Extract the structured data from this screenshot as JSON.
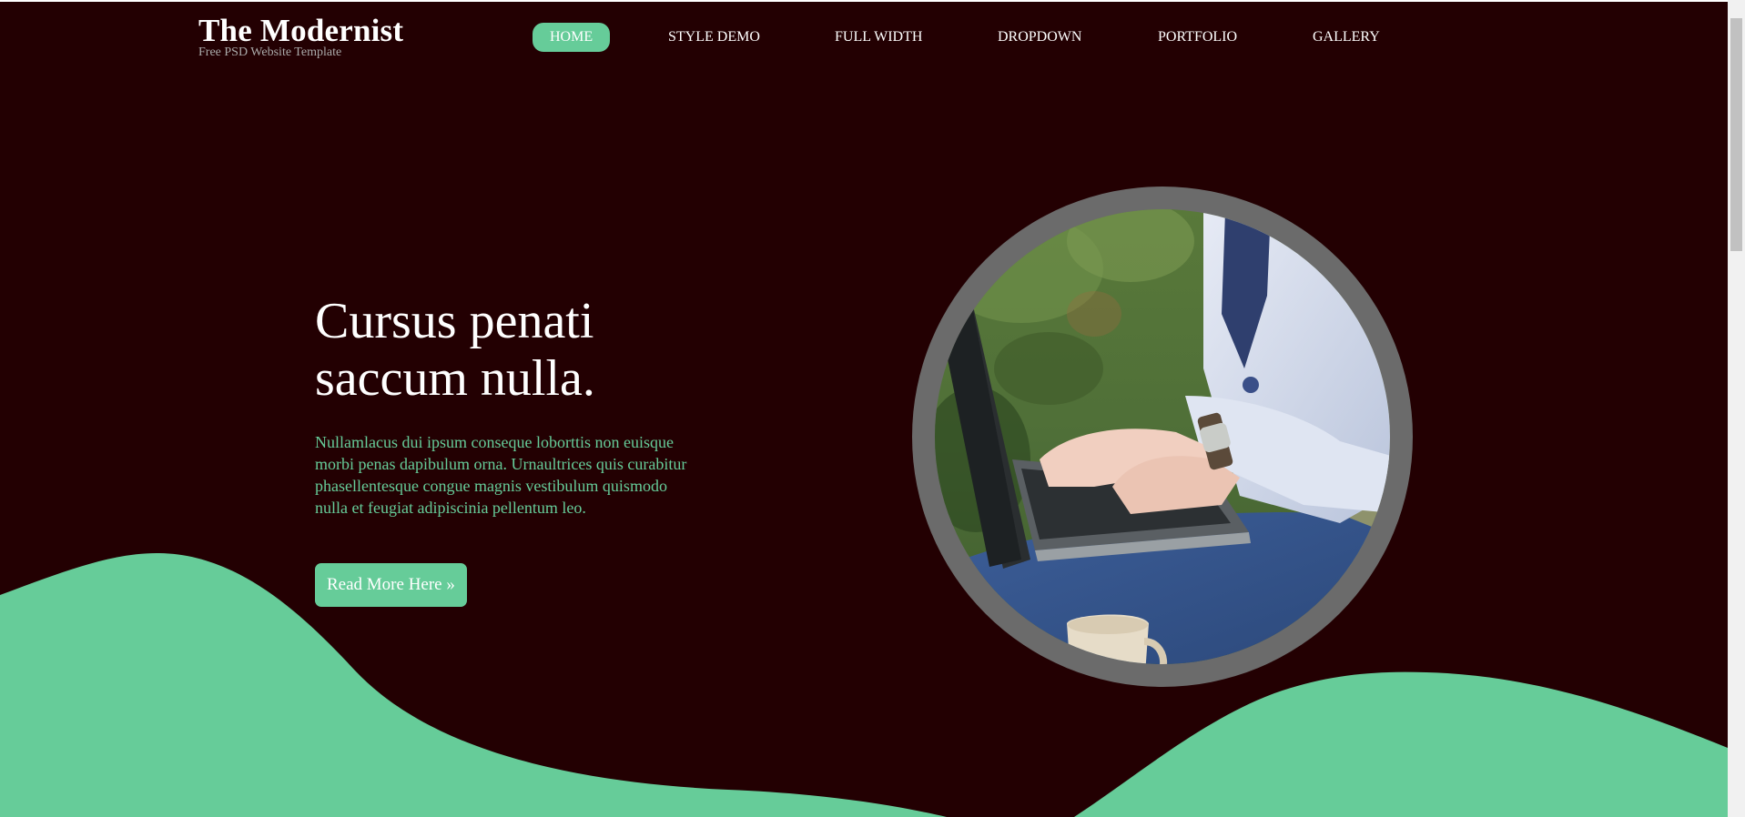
{
  "logo": {
    "title": "The Modernist",
    "tagline": "Free PSD Website Template"
  },
  "nav": {
    "items": [
      {
        "label": "HOME",
        "active": true
      },
      {
        "label": "STYLE DEMO",
        "active": false
      },
      {
        "label": "FULL WIDTH",
        "active": false
      },
      {
        "label": "DROPDOWN",
        "active": false
      },
      {
        "label": "PORTFOLIO",
        "active": false
      },
      {
        "label": "GALLERY",
        "active": false
      }
    ]
  },
  "hero": {
    "heading_line1": "Cursus penati",
    "heading_line2": "saccum nulla.",
    "text": "Nullamlacus dui ipsum conseque loborttis non euisque morbi penas dapibulum orna. Urnaultrices quis curabitur phasellentesque congue magnis vestibulum quismodo nulla et feugiat adipiscinia pellentum leo.",
    "button_label": "Read More Here »"
  },
  "colors": {
    "background": "#230002",
    "accent": "#66cc99",
    "circle_border": "#6b6b6b"
  },
  "icons": {
    "photo": "laptop-typing-photo"
  }
}
